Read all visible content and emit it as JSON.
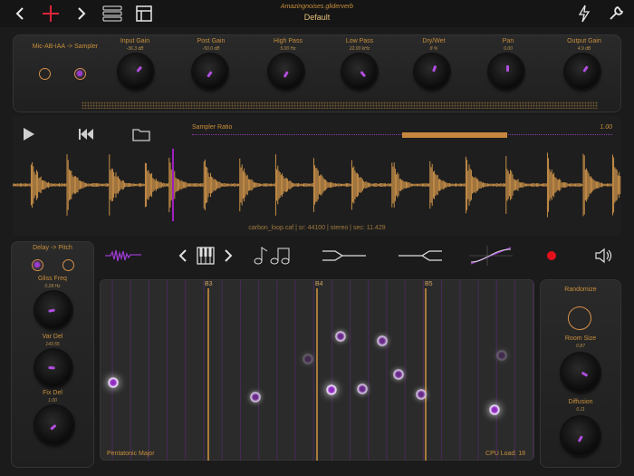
{
  "header": {
    "preset_file": "Amazingnoises.gliderverb",
    "preset_name": "Default",
    "icons": [
      "chevron-left-icon",
      "add-icon",
      "chevron-right-icon",
      "menu-icon",
      "layout-icon",
      "lightning-icon",
      "wrench-icon"
    ]
  },
  "input_section": {
    "mode_label": "Mic-AB-IAA -> Sampler",
    "mode_radios": [
      {
        "selected": false
      },
      {
        "selected": true
      }
    ],
    "knobs": [
      {
        "label": "Input Gain",
        "value": "-36.3 dB"
      },
      {
        "label": "Post Gain",
        "value": "-50.0 dB"
      },
      {
        "label": "High Pass",
        "value": "5.00 Hz"
      },
      {
        "label": "Low Pass",
        "value": "22.00 kHz"
      },
      {
        "label": "Dry/Wet",
        "value": "8 %"
      },
      {
        "label": "Pan",
        "value": "0.00"
      },
      {
        "label": "Output Gain",
        "value": "4.9 dB"
      }
    ]
  },
  "sampler": {
    "ratio_label": "Sampler Ratio",
    "ratio_value": "1.00",
    "sample_info": "carbon_loop.caf | sr: 44100 | stereo | sec: 11.429",
    "wave_color": "#d89a4c",
    "playhead_color": "#a020c0"
  },
  "delay_section": {
    "mode_label": "Delay -> Pitch",
    "mode_radios": [
      {
        "selected": true
      },
      {
        "selected": false
      }
    ],
    "knobs": [
      {
        "label": "Gliss Freq",
        "value": "0.28 Hz"
      },
      {
        "label": "Var Del",
        "value": "143.55"
      },
      {
        "label": "Fix Del",
        "value": "1.00"
      }
    ]
  },
  "reverb_section": {
    "randomize_label": "Randomize",
    "knobs": [
      {
        "label": "Room Size",
        "value": "0.87"
      },
      {
        "label": "Diffusion",
        "value": "0.11"
      }
    ]
  },
  "pitch_grid": {
    "note_labels": [
      "B3",
      "B4",
      "B5"
    ],
    "scale": "Pentatonic Major",
    "cpu_load": "CPU Load: 18"
  },
  "toolbar_icons": [
    "waveform-thumb-icon",
    "chevron-left-icon",
    "piano-icon",
    "chevron-right-icon",
    "music-note-icon",
    "crossfade-icon",
    "split-icon",
    "curve-icon",
    "record-icon",
    "speaker-icon"
  ]
}
